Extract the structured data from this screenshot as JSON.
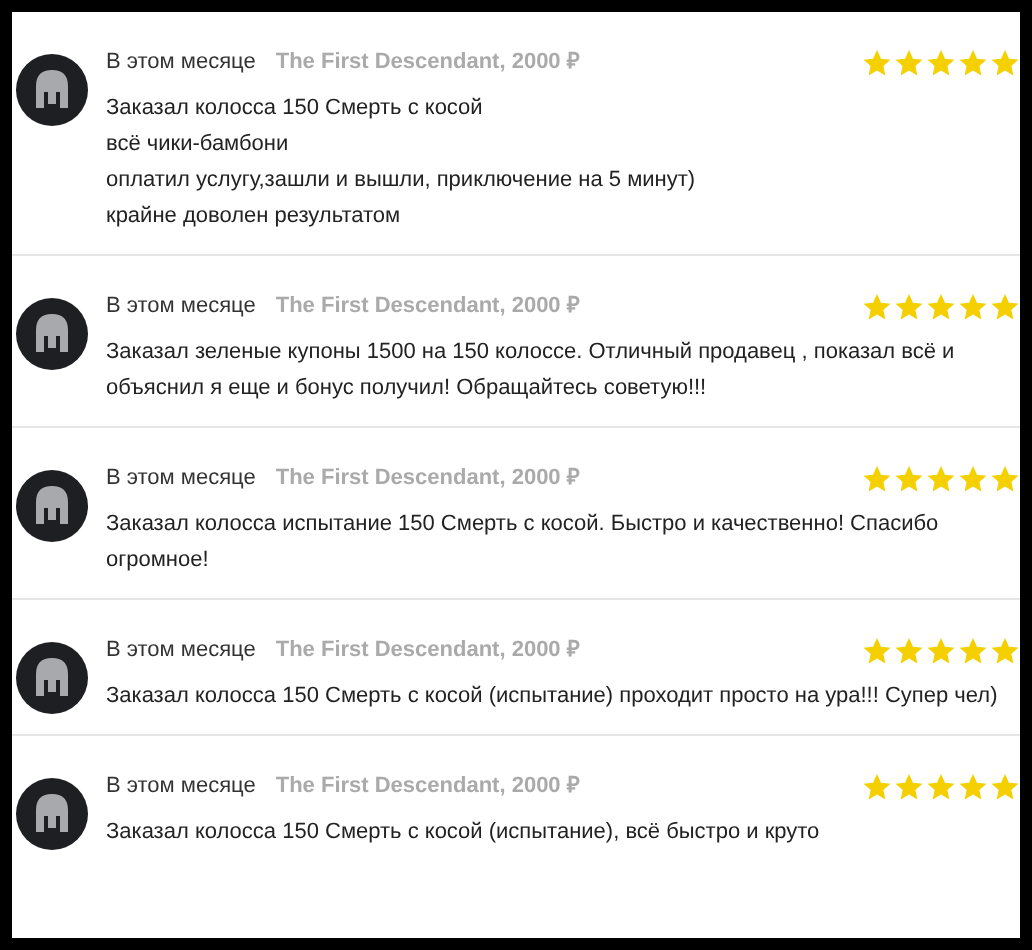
{
  "reviews": [
    {
      "when": "В этом месяце",
      "product": "The First Descendant, 2000 ₽",
      "stars": 5,
      "lines": [
        "Заказал колосса 150 Смерть с косой",
        "всё чики-бамбони",
        "оплатил услугу,зашли и вышли, приключение на 5 минут)",
        "крайне доволен результатом"
      ]
    },
    {
      "when": "В этом месяце",
      "product": "The First Descendant, 2000 ₽",
      "stars": 5,
      "lines": [
        "Заказал зеленые купоны 1500 на 150 колоссе. Отличный продавец , показал всё и объяснил я еще и бонус получил! Обращайтесь советую!!!"
      ]
    },
    {
      "when": "В этом месяце",
      "product": "The First Descendant, 2000 ₽",
      "stars": 5,
      "lines": [
        "Заказал колосса испытание 150 Смерть с косой. Быстро и качественно! Спасибо огромное!"
      ]
    },
    {
      "when": "В этом месяце",
      "product": "The First Descendant, 2000 ₽",
      "stars": 5,
      "lines": [
        "Заказал колосса 150 Смерть с косой (испытание) проходит просто на ура!!! Супер чел)"
      ]
    },
    {
      "when": "В этом месяце",
      "product": "The First Descendant, 2000 ₽",
      "stars": 5,
      "lines": [
        "Заказал колосса 150 Смерть с косой (испытание), всё быстро и круто"
      ]
    }
  ]
}
